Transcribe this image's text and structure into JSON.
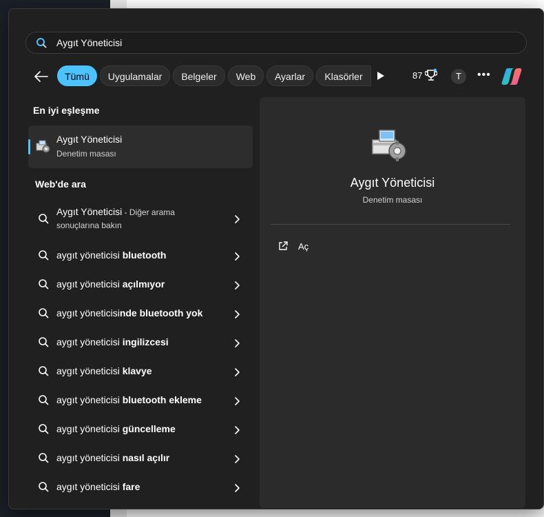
{
  "search": {
    "value": "Aygıt Yöneticisi"
  },
  "filters": {
    "chips": [
      {
        "label": "Tümü",
        "active": true
      },
      {
        "label": "Uygulamalar",
        "active": false
      },
      {
        "label": "Belgeler",
        "active": false
      },
      {
        "label": "Web",
        "active": false
      },
      {
        "label": "Ayarlar",
        "active": false
      },
      {
        "label": "Klasörler",
        "active": false
      }
    ],
    "points": "87",
    "avatar_letter": "T"
  },
  "best_match": {
    "heading": "En iyi eşleşme",
    "title": "Aygıt Yöneticisi",
    "subtitle": "Denetim masası"
  },
  "web": {
    "heading": "Web'de ara",
    "first": {
      "query": "Aygıt Yöneticisi",
      "suffix": " - Diğer arama",
      "line2": "sonuçlarına bakın"
    },
    "suggestions": [
      {
        "prefix": "aygıt yöneticisi",
        "bold": " bluetooth"
      },
      {
        "prefix": "aygıt yöneticisi",
        "bold": " açılmıyor"
      },
      {
        "prefix": "aygıt yöneticisi",
        "bold": "nde bluetooth yok"
      },
      {
        "prefix": "aygıt yöneticisi",
        "bold": " ingilizcesi"
      },
      {
        "prefix": "aygıt yöneticisi",
        "bold": " klavye"
      },
      {
        "prefix": "aygıt yöneticisi",
        "bold": " bluetooth ekleme"
      },
      {
        "prefix": "aygıt yöneticisi",
        "bold": " güncelleme"
      },
      {
        "prefix": "aygıt yöneticisi",
        "bold": " nasıl açılır"
      },
      {
        "prefix": "aygıt yöneticisi",
        "bold": " fare"
      }
    ]
  },
  "preview": {
    "title": "Aygıt Yöneticisi",
    "subtitle": "Denetim masası",
    "open_label": "Aç"
  },
  "colors": {
    "accent": "#4cc2ff",
    "panel": "#202020",
    "preview": "#2b2b2b"
  }
}
